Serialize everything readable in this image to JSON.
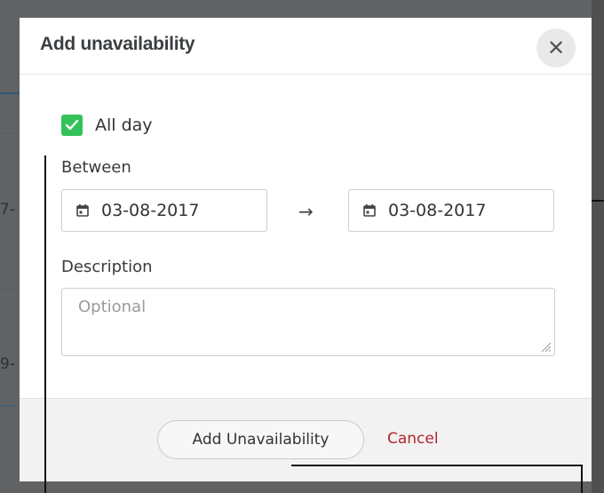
{
  "dialog": {
    "title": "Add unavailability",
    "close_glyph": "✕",
    "all_day": {
      "label": "All day",
      "checked": true
    },
    "between": {
      "label": "Between",
      "start_date": "03-08-2017",
      "end_date": "03-08-2017",
      "separator": "→"
    },
    "description": {
      "label": "Description",
      "value": "",
      "placeholder": "Optional"
    },
    "footer": {
      "submit_label": "Add Unavailability",
      "cancel_label": "Cancel"
    }
  },
  "colors": {
    "checkbox_green": "#33c25a",
    "cancel_red": "#b3262c",
    "footer_bg": "#f2f2f2",
    "backdrop": "#606264"
  },
  "icons": {
    "close": "close-icon",
    "check": "check-icon",
    "calendar": "calendar-icon",
    "arrow": "arrow-right-icon",
    "resize": "resize-grip-icon"
  }
}
